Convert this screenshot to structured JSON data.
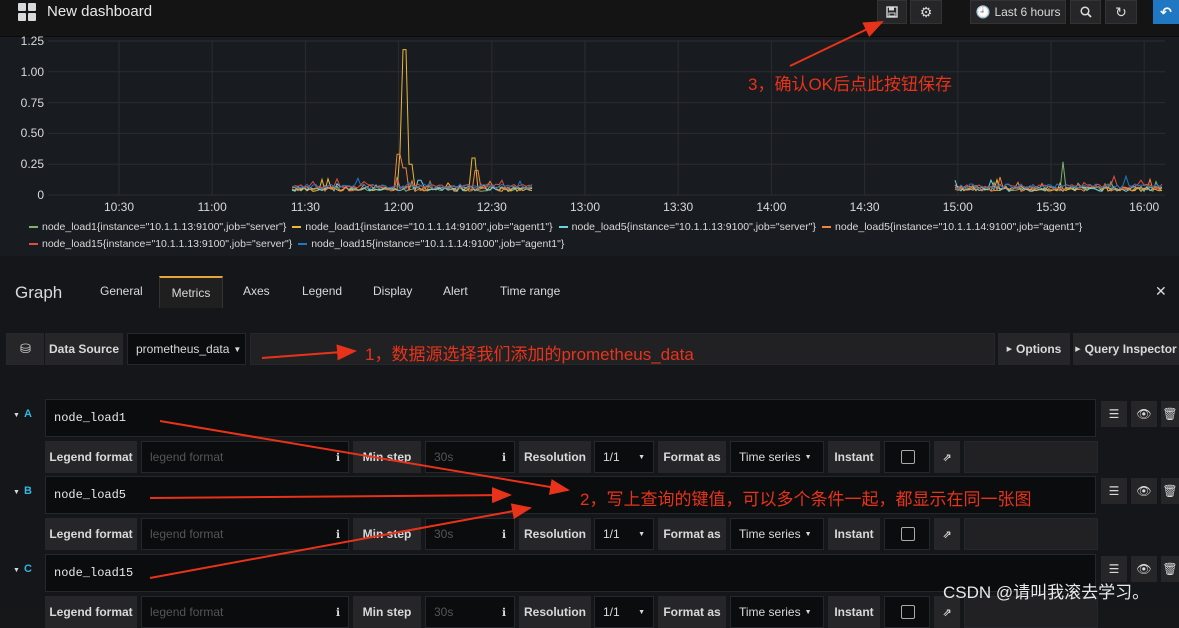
{
  "topbar": {
    "title": "New dashboard",
    "time_range": "Last 6 hours",
    "icons": [
      "save-icon",
      "gear-icon",
      "clock-icon",
      "zoom-out-icon",
      "refresh-icon",
      "back-icon"
    ]
  },
  "chart_data": {
    "type": "line",
    "y_ticks": [
      "1.25",
      "1.00",
      "0.75",
      "0.50",
      "0.25",
      "0"
    ],
    "x_ticks": [
      "10:30",
      "11:00",
      "11:30",
      "12:00",
      "12:30",
      "13:00",
      "13:30",
      "14:00",
      "14:30",
      "15:00",
      "15:30",
      "16:00"
    ],
    "ylim": [
      0,
      1.25
    ],
    "grid": true,
    "legend_placement": "bottom",
    "series": [
      {
        "name": "node_load1{instance=\"10.1.1.13:9100\",job=\"server\"}",
        "color": "#7eb26d"
      },
      {
        "name": "node_load1{instance=\"10.1.1.14:9100\",job=\"agent1\"}",
        "color": "#eab839"
      },
      {
        "name": "node_load5{instance=\"10.1.1.13:9100\",job=\"server\"}",
        "color": "#6ed0e0"
      },
      {
        "name": "node_load5{instance=\"10.1.1.14:9100\",job=\"agent1\"}",
        "color": "#ef843c"
      },
      {
        "name": "node_load15{instance=\"10.1.1.13:9100\",job=\"server\"}",
        "color": "#e24d42"
      },
      {
        "name": "node_load15{instance=\"10.1.1.14:9100\",job=\"agent1\"}",
        "color": "#1f78c1"
      }
    ]
  },
  "editor": {
    "panel_title": "Graph",
    "tabs": [
      "General",
      "Metrics",
      "Axes",
      "Legend",
      "Display",
      "Alert",
      "Time range"
    ],
    "active_tab": "Metrics",
    "datasource_label": "Data Source",
    "datasource_value": "prometheus_data",
    "options_label": "Options",
    "query_inspector_label": "Query Inspector",
    "queries": [
      {
        "ref": "A",
        "expr": "node_load1"
      },
      {
        "ref": "B",
        "expr": "node_load5"
      },
      {
        "ref": "C",
        "expr": "node_load15"
      }
    ],
    "row_labels": {
      "legend_format": "Legend format",
      "legend_placeholder": "legend format",
      "min_step": "Min step",
      "min_step_placeholder": "30s",
      "resolution": "Resolution",
      "resolution_value": "1/1",
      "format_as": "Format as",
      "format_value": "Time series",
      "instant": "Instant"
    }
  },
  "annotations": {
    "a1": "1，数据源选择我们添加的prometheus_data",
    "a2": "2，写上查询的键值，可以多个条件一起，都显示在同一张图",
    "a3": "3，确认OK后点此按钮保存"
  },
  "watermark": "CSDN @请叫我滚去学习。"
}
